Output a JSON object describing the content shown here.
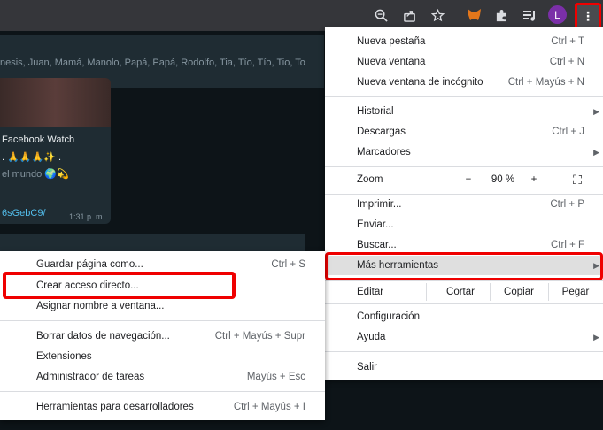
{
  "toolbar": {
    "icons": [
      "zoom-icon",
      "share-icon",
      "star-icon",
      "metamask-icon",
      "puzzle-icon",
      "media-icon",
      "avatar",
      "kebab-menu-icon"
    ],
    "avatar_letter": "L",
    "menu_glyph": "⋮",
    "highlight_color": "#ef0000"
  },
  "chat": {
    "participants": "nesis, Juan, Mamá, Manolo, Papá, Papá, Rodolfo, Tia, Tío, Tío, Tio, To",
    "bubble_title": "Facebook Watch",
    "bubble_emoji": ". 🙏🙏🙏✨ .",
    "bubble_text": "el mundo 🌍💫",
    "link_text": "6sGebC9/",
    "time": "1:31 p. m."
  },
  "main_menu": {
    "new_tab": {
      "label": "Nueva pestaña",
      "shortcut": "Ctrl + T"
    },
    "new_window": {
      "label": "Nueva ventana",
      "shortcut": "Ctrl + N"
    },
    "incognito": {
      "label": "Nueva ventana de incógnito",
      "shortcut": "Ctrl + Mayús + N"
    },
    "history": {
      "label": "Historial"
    },
    "downloads": {
      "label": "Descargas",
      "shortcut": "Ctrl + J"
    },
    "bookmarks": {
      "label": "Marcadores"
    },
    "zoom": {
      "label": "Zoom",
      "minus": "−",
      "value": "90 %",
      "plus": "+",
      "fullscreen": "⛶"
    },
    "print": {
      "label": "Imprimir...",
      "shortcut": "Ctrl + P"
    },
    "cast": {
      "label": "Enviar..."
    },
    "find": {
      "label": "Buscar...",
      "shortcut": "Ctrl + F"
    },
    "more_tools": {
      "label": "Más herramientas"
    },
    "edit": {
      "label": "Editar",
      "cut": "Cortar",
      "copy": "Copiar",
      "paste": "Pegar"
    },
    "settings": {
      "label": "Configuración"
    },
    "help": {
      "label": "Ayuda"
    },
    "exit": {
      "label": "Salir"
    },
    "arrow": "▶"
  },
  "sub_menu": {
    "save_page": {
      "label": "Guardar página como...",
      "shortcut": "Ctrl + S"
    },
    "create_shortcut": {
      "label": "Crear acceso directo..."
    },
    "name_window": {
      "label": "Asignar nombre a ventana..."
    },
    "clear_data": {
      "label": "Borrar datos de navegación...",
      "shortcut": "Ctrl + Mayús + Supr"
    },
    "extensions": {
      "label": "Extensiones"
    },
    "task_manager": {
      "label": "Administrador de tareas",
      "shortcut": "Mayús + Esc"
    },
    "dev_tools": {
      "label": "Herramientas para desarrolladores",
      "shortcut": "Ctrl + Mayús + I"
    }
  }
}
